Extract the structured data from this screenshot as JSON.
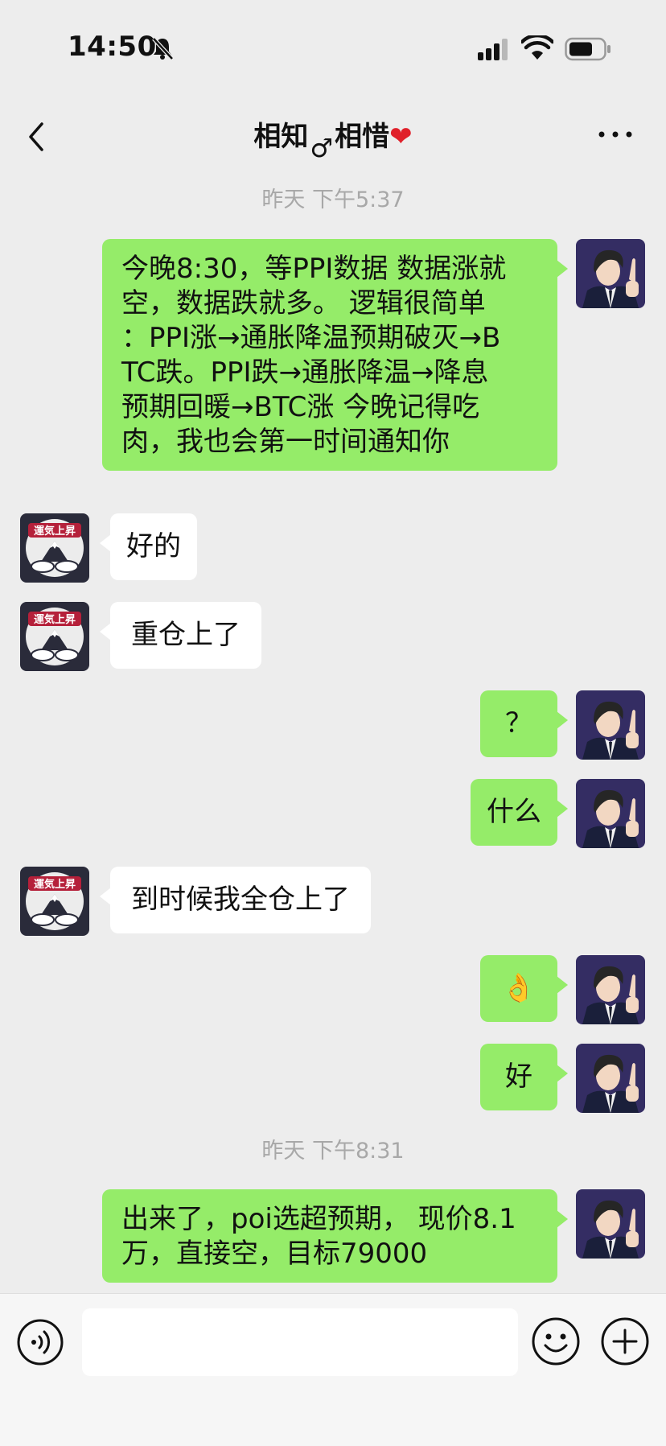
{
  "status_bar": {
    "time": "14:50"
  },
  "header": {
    "name_part1": "相知",
    "male_symbol": "♂",
    "name_part2": "相惜",
    "heart": "❤"
  },
  "messages": [
    {
      "type": "timestamp",
      "text": "昨天 下午5:37"
    },
    {
      "type": "sent",
      "avatar": "anime-businessman-avatar",
      "lines": [
        "今晚8:30，等PPI数据 数据涨就",
        "空，数据跌就多。 逻辑很简单",
        "：PPI涨→通胀降温预期破灭→B",
        "TC跌。PPI跌→通胀降温→降息",
        "预期回暖→BTC涨 今晚记得吃",
        "肉，我也会第一时间通知你"
      ]
    },
    {
      "type": "received",
      "avatar": "good-luck-mountain-avatar",
      "text": "好的"
    },
    {
      "type": "received",
      "avatar": "good-luck-mountain-avatar",
      "text": "重仓上了"
    },
    {
      "type": "sent",
      "avatar": "anime-businessman-avatar",
      "text": "？"
    },
    {
      "type": "sent",
      "avatar": "anime-businessman-avatar",
      "text": "什么"
    },
    {
      "type": "received",
      "avatar": "good-luck-mountain-avatar",
      "text": "到时候我全仓上了"
    },
    {
      "type": "sent",
      "avatar": "anime-businessman-avatar",
      "text": "👌"
    },
    {
      "type": "sent",
      "avatar": "anime-businessman-avatar",
      "text": "好"
    },
    {
      "type": "timestamp",
      "text": "昨天 下午8:31"
    },
    {
      "type": "sent",
      "avatar": "anime-businessman-avatar",
      "lines": [
        "出来了，poi选超预期， 现价8.1",
        "万，直接空，目标79000"
      ]
    }
  ],
  "avatar_other_text": "運気上昇",
  "input_bar": {
    "placeholder": ""
  }
}
